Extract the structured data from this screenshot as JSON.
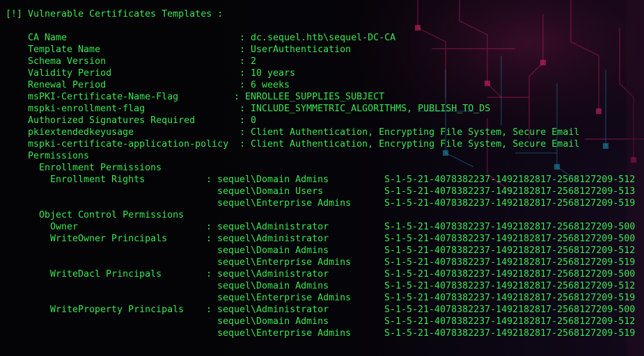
{
  "terminal": {
    "header": "[!] Vulnerable Certificates Templates :",
    "fields": [
      {
        "key": "CA Name",
        "value": ": dc.sequel.htb\\sequel-DC-CA"
      },
      {
        "key": "Template Name",
        "value": ": UserAuthentication"
      },
      {
        "key": "Schema Version",
        "value": ": 2"
      },
      {
        "key": "Validity Period",
        "value": ": 10 years"
      },
      {
        "key": "Renewal Period",
        "value": ": 6 weeks"
      },
      {
        "key": "msPKI-Certificate-Name-Flag",
        "value": ": ENROLLEE_SUPPLIES_SUBJECT"
      },
      {
        "key": "mspki-enrollment-flag",
        "value": ": INCLUDE_SYMMETRIC_ALGORITHMS, PUBLISH_TO_DS"
      },
      {
        "key": "Authorized Signatures Required",
        "value": ": 0"
      },
      {
        "key": "pkiextendedkeyusage",
        "value": ": Client Authentication, Encrypting File System, Secure Email"
      },
      {
        "key": "mspki-certificate-application-policy",
        "value": ": Client Authentication, Encrypting File System, Secure Email"
      }
    ],
    "permissions_heading": "Permissions",
    "enrollment_heading": "Enrollment Permissions",
    "enrollment_rights": {
      "label": "Enrollment Rights",
      "entries": [
        {
          "principal": ": sequel\\Domain Admins",
          "sid": "S-1-5-21-4078382237-1492182817-2568127209-512"
        },
        {
          "principal": "sequel\\Domain Users",
          "sid": "S-1-5-21-4078382237-1492182817-2568127209-513"
        },
        {
          "principal": "sequel\\Enterprise Admins",
          "sid": "S-1-5-21-4078382237-1492182817-2568127209-519"
        }
      ]
    },
    "object_control_heading": "Object Control Permissions",
    "owner": {
      "label": "Owner",
      "entries": [
        {
          "principal": ": sequel\\Administrator",
          "sid": "S-1-5-21-4078382237-1492182817-2568127209-500"
        }
      ]
    },
    "write_owner": {
      "label": "WriteOwner Principals",
      "entries": [
        {
          "principal": ": sequel\\Administrator",
          "sid": "S-1-5-21-4078382237-1492182817-2568127209-500"
        },
        {
          "principal": "sequel\\Domain Admins",
          "sid": "S-1-5-21-4078382237-1492182817-2568127209-512"
        },
        {
          "principal": "sequel\\Enterprise Admins",
          "sid": "S-1-5-21-4078382237-1492182817-2568127209-519"
        }
      ]
    },
    "write_dacl": {
      "label": "WriteDacl Principals",
      "entries": [
        {
          "principal": ": sequel\\Administrator",
          "sid": "S-1-5-21-4078382237-1492182817-2568127209-500"
        },
        {
          "principal": "sequel\\Domain Admins",
          "sid": "S-1-5-21-4078382237-1492182817-2568127209-512"
        },
        {
          "principal": "sequel\\Enterprise Admins",
          "sid": "S-1-5-21-4078382237-1492182817-2568127209-519"
        }
      ]
    },
    "write_property": {
      "label": "WriteProperty Principals",
      "entries": [
        {
          "principal": ": sequel\\Administrator",
          "sid": "S-1-5-21-4078382237-1492182817-2568127209-500"
        },
        {
          "principal": "sequel\\Domain Admins",
          "sid": "S-1-5-21-4078382237-1492182817-2568127209-512"
        },
        {
          "principal": "sequel\\Enterprise Admins",
          "sid": "S-1-5-21-4078382237-1492182817-2568127209-519"
        }
      ]
    },
    "colors": {
      "text": "#38e850",
      "background": "#050308",
      "accent_pink": "#d0206a",
      "accent_cyan": "#1fa0c8"
    }
  }
}
